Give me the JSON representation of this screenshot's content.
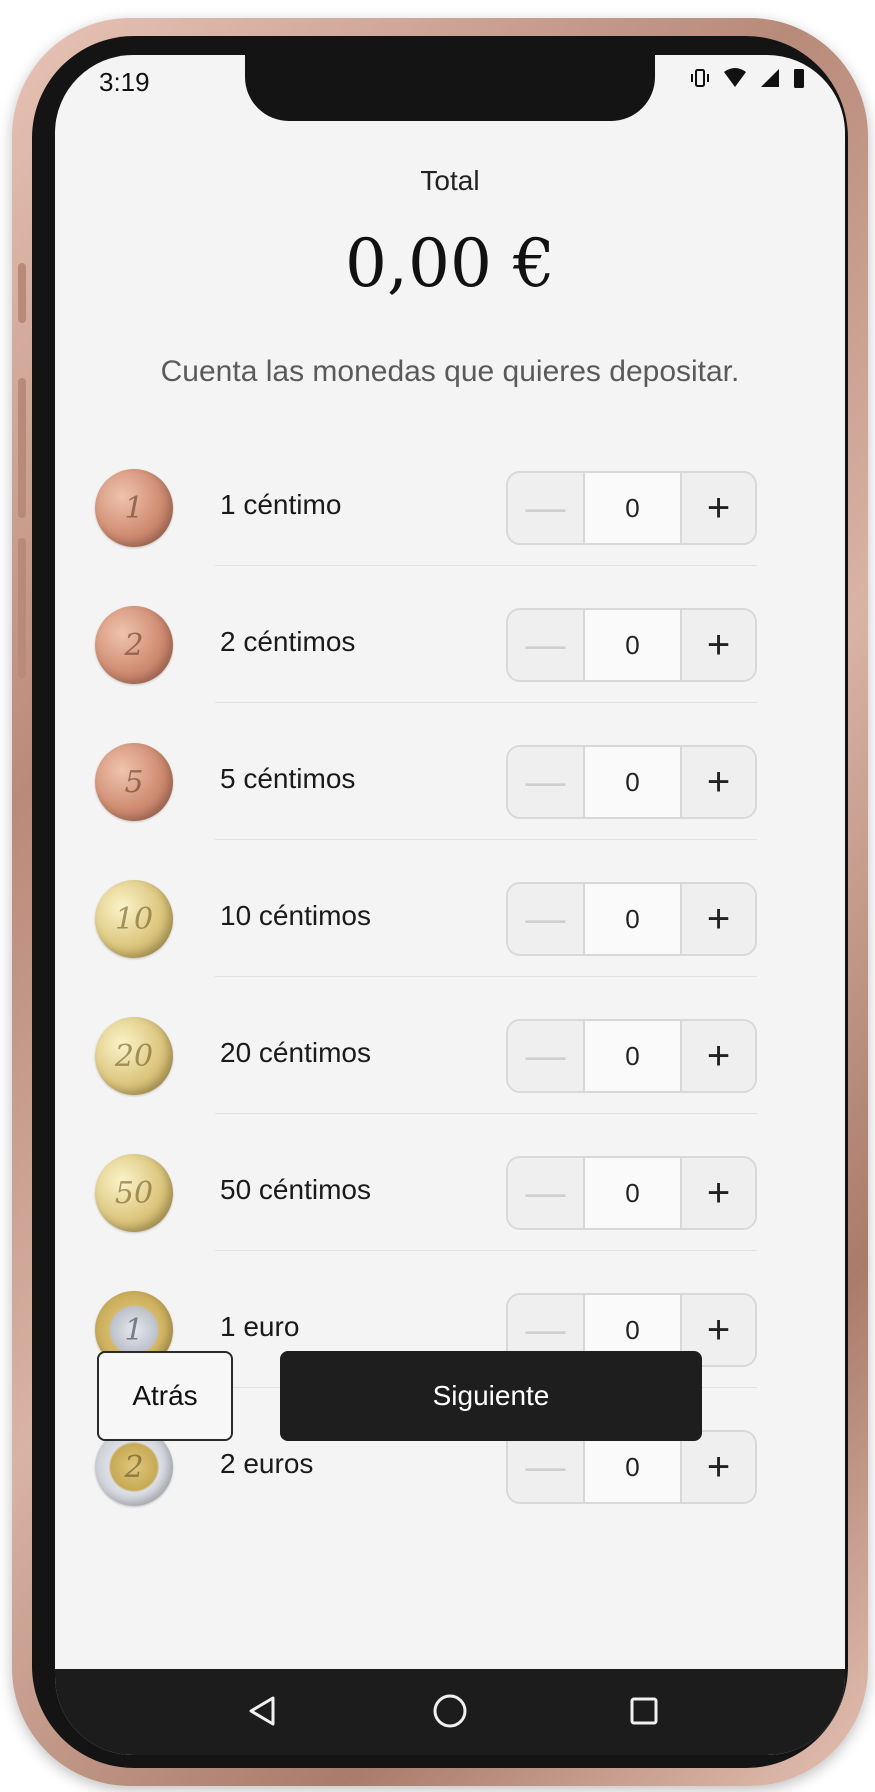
{
  "status_bar": {
    "time": "3:19",
    "icons": [
      "vibrate-icon",
      "wifi-icon",
      "signal-icon",
      "battery-icon"
    ]
  },
  "header": {
    "total_label": "Total",
    "total_amount": "0,00 €",
    "instruction": "Cuenta las monedas que quieres depositar."
  },
  "coins": [
    {
      "label": "1 céntimo",
      "value": "0",
      "coin_face": "1",
      "metal": "copper"
    },
    {
      "label": "2 céntimos",
      "value": "0",
      "coin_face": "2",
      "metal": "copper"
    },
    {
      "label": "5 céntimos",
      "value": "0",
      "coin_face": "5",
      "metal": "copper"
    },
    {
      "label": "10 céntimos",
      "value": "0",
      "coin_face": "10",
      "metal": "gold"
    },
    {
      "label": "20 céntimos",
      "value": "0",
      "coin_face": "20",
      "metal": "gold"
    },
    {
      "label": "50 céntimos",
      "value": "0",
      "coin_face": "50",
      "metal": "gold"
    },
    {
      "label": "1 euro",
      "value": "0",
      "coin_face": "1",
      "metal": "bimetal-silver-center"
    },
    {
      "label": "2 euros",
      "value": "0",
      "coin_face": "2",
      "metal": "bimetal-gold-center"
    }
  ],
  "stepper": {
    "minus_symbol": "—",
    "plus_symbol": "+"
  },
  "footer": {
    "back_label": "Atrás",
    "next_label": "Siguiente"
  },
  "colors": {
    "screen_bg": "#f4f4f4",
    "primary_button": "#1e1e1e",
    "frame": "#b88a7a"
  }
}
